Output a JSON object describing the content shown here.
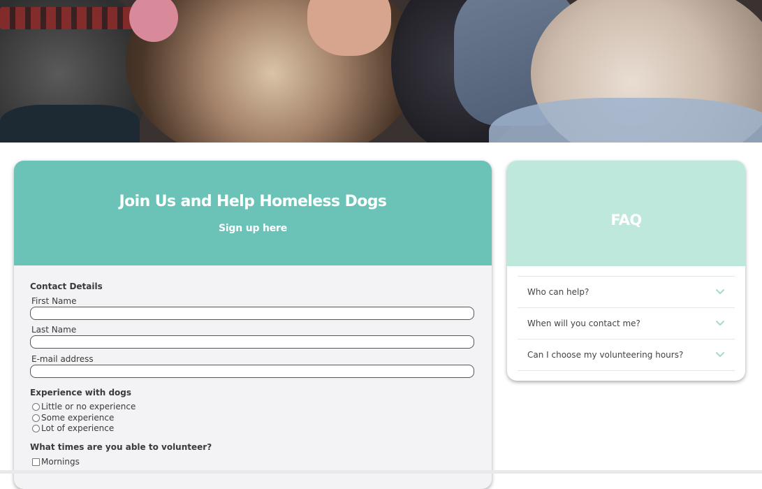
{
  "signup": {
    "title": "Join Us and Help Homeless Dogs",
    "subtitle": "Sign up here",
    "contact_heading": "Contact Details",
    "fields": [
      {
        "label": "First Name",
        "value": ""
      },
      {
        "label": "Last Name",
        "value": ""
      },
      {
        "label": "E-mail address",
        "value": ""
      }
    ],
    "experience_heading": "Experience with dogs",
    "experience_options": [
      "Little or no experience",
      "Some experience",
      "Lot of experience"
    ],
    "times_heading": "What times are you able to volunteer?",
    "times_options": [
      "Mornings"
    ]
  },
  "faq": {
    "title": "FAQ",
    "items": [
      "Who can help?",
      "When will you contact me?",
      "Can I choose my volunteering hours?"
    ]
  },
  "colors": {
    "signup_header": "#6bc3b8",
    "faq_header": "#bde8db",
    "chevron": "#a7d8c8"
  },
  "icons": {
    "faq_toggle": "chevron-down-icon"
  }
}
